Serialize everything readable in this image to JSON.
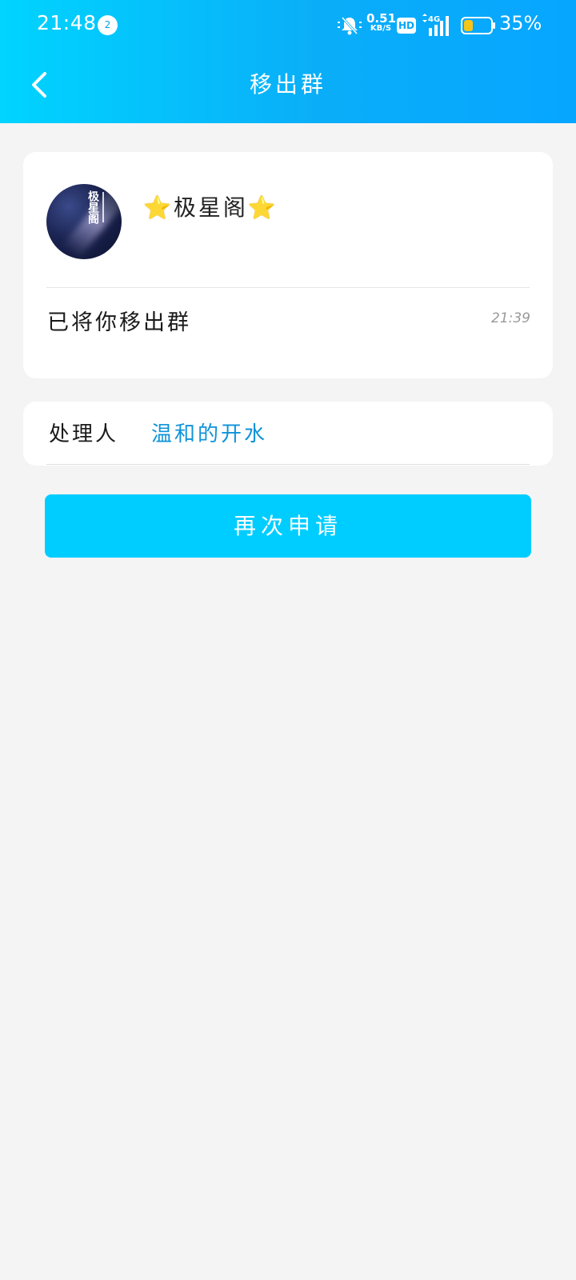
{
  "status_bar": {
    "time": "21:48",
    "notification_count": "2",
    "net_speed_value": "0.51",
    "net_speed_unit": "KB/S",
    "hd_label": "HD",
    "network_type": "4G",
    "battery_percent": "35%",
    "battery_level": 0.35,
    "battery_fill_color": "#f5c518"
  },
  "header": {
    "title": "移出群",
    "back_icon": "chevron-left-icon",
    "gradient_start": "#00d4ff",
    "gradient_end": "#06a6ff"
  },
  "group_card": {
    "star_left": "⭐",
    "group_name": "极星阁",
    "star_right": "⭐",
    "avatar_text": "极星阁",
    "message": "已将你移出群",
    "message_time": "21:39"
  },
  "handler_card": {
    "label": "处理人",
    "name": "温和的开水",
    "name_color": "#0f93d8"
  },
  "actions": {
    "reapply_label": "再次申请",
    "button_color": "#00cdff"
  }
}
